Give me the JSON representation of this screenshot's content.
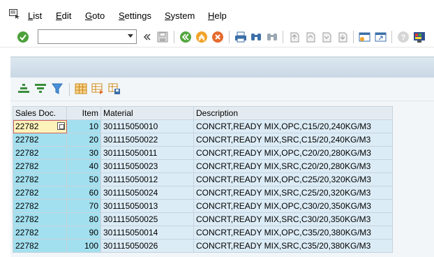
{
  "menu": {
    "items": [
      {
        "underlined": "L",
        "rest": "ist"
      },
      {
        "underlined": "E",
        "rest": "dit"
      },
      {
        "underlined": "G",
        "rest": "oto"
      },
      {
        "underlined": "S",
        "rest": "ettings"
      },
      {
        "underlined": "S",
        "rest": "ystem"
      },
      {
        "underlined": "H",
        "rest": "elp"
      }
    ]
  },
  "toolbar": {
    "command_field_value": "",
    "icons": [
      "enter-icon",
      "save-icon",
      "back-icon",
      "exit-icon",
      "cancel-icon",
      "print-icon",
      "find-icon",
      "find-next-icon",
      "first-page-icon",
      "previous-page-icon",
      "next-page-icon",
      "last-page-icon",
      "create-session-icon",
      "shortcut-icon",
      "help-icon",
      "customize-layout-icon"
    ]
  },
  "alv_toolbar": {
    "icons": [
      "sort-ascending-icon",
      "sort-descending-icon",
      "filter-icon",
      "change-layout-icon",
      "select-layout-icon",
      "save-layout-icon"
    ]
  },
  "grid": {
    "columns": [
      "Sales Doc.",
      "Item",
      "Material",
      "Description"
    ],
    "rows": [
      {
        "sales_doc": "22782",
        "item": "10",
        "material": "301115050010",
        "description": "CONCRT,READY MIX,OPC,C15/20,240KG/M3"
      },
      {
        "sales_doc": "22782",
        "item": "20",
        "material": "301115050022",
        "description": "CONCRT,READY MIX,SRC,C15/20,240KG/M3"
      },
      {
        "sales_doc": "22782",
        "item": "30",
        "material": "301115050011",
        "description": "CONCRT,READY MIX,OPC,C20/20,280KG/M3"
      },
      {
        "sales_doc": "22782",
        "item": "40",
        "material": "301115050023",
        "description": "CONCRT,READY MIX,SRC,C20/20,280KG/M3"
      },
      {
        "sales_doc": "22782",
        "item": "50",
        "material": "301115050012",
        "description": "CONCRT,READY MIX,OPC,C25/20,320KG/M3"
      },
      {
        "sales_doc": "22782",
        "item": "60",
        "material": "301115050024",
        "description": "CONCRT,READY MIX,SRC,C25/20,320KG/M3"
      },
      {
        "sales_doc": "22782",
        "item": "70",
        "material": "301115050013",
        "description": "CONCRT,READY MIX,OPC,C30/20,350KG/M3"
      },
      {
        "sales_doc": "22782",
        "item": "80",
        "material": "301115050025",
        "description": "CONCRT,READY MIX,SRC,C30/20,350KG/M3"
      },
      {
        "sales_doc": "22782",
        "item": "90",
        "material": "301115050014",
        "description": "CONCRT,READY MIX,OPC,C35/20,380KG/M3"
      },
      {
        "sales_doc": "22782",
        "item": "100",
        "material": "301115050026",
        "description": "CONCRT,READY MIX,SRC,C35/20,380KG/M3"
      }
    ]
  },
  "colors": {
    "key_column": "#a3e0ef",
    "data_column": "#dcecf6",
    "focused_cell": "#fdf3ba",
    "title_band": "#c9d8e4"
  }
}
